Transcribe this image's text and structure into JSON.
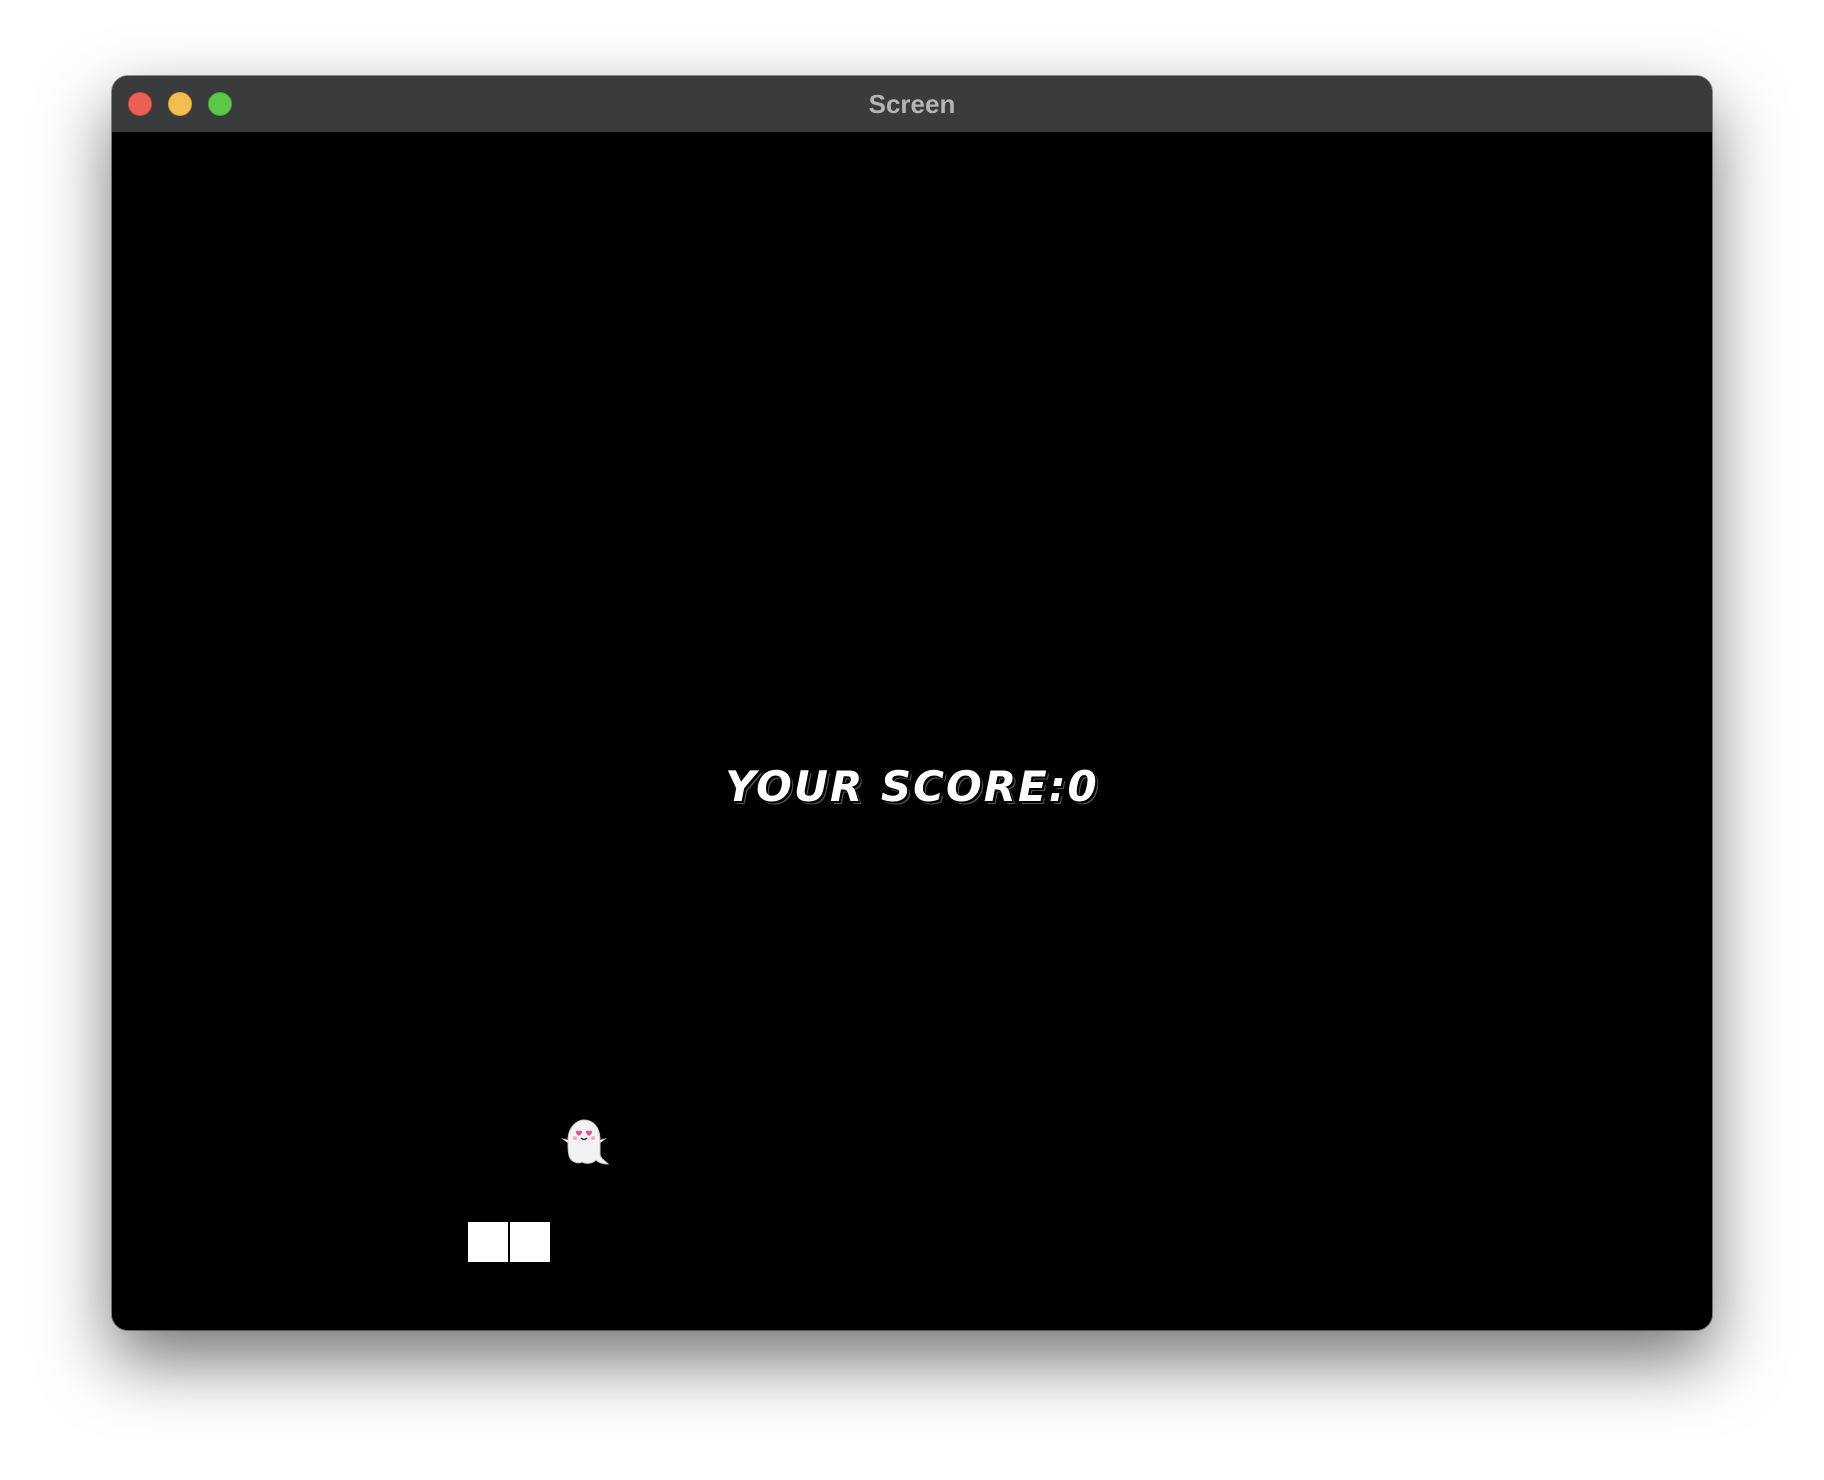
{
  "window": {
    "title": "Screen"
  },
  "game": {
    "score_text": "YOUR SCORE:0",
    "player": "ghost-sprite",
    "blocks": 2
  },
  "colors": {
    "background": "#000000",
    "titlebar": "#393b3c",
    "text": "#ffffff",
    "close": "#ec5f57",
    "minimize": "#f4bd4f",
    "zoom": "#5cc748"
  }
}
